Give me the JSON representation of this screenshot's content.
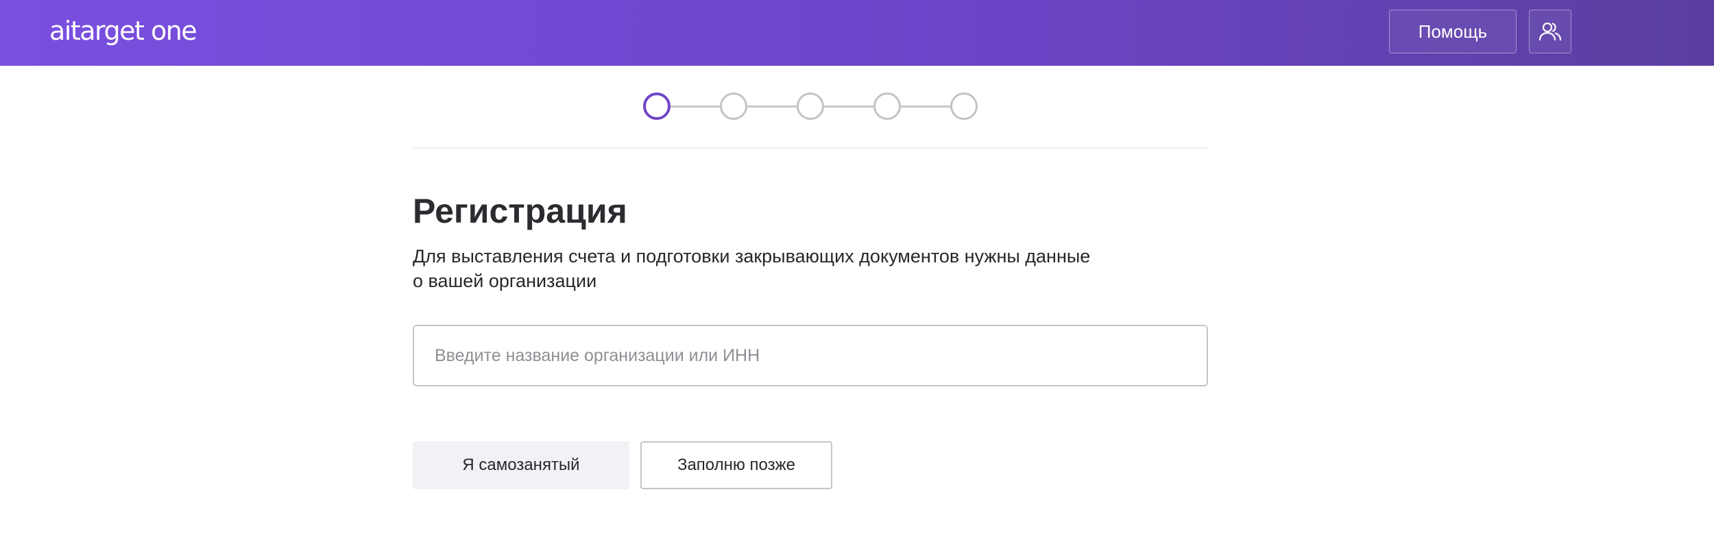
{
  "header": {
    "logo_text": "aitarget one",
    "help_label": "Помощь",
    "account_icon": "users-icon",
    "gradient_start": "#7a4fe0",
    "gradient_end": "#5a3fa0"
  },
  "stepper": {
    "total_steps": 5,
    "current_step": 1,
    "active_color": "#6e44c8",
    "inactive_color": "#c2c3c7"
  },
  "main": {
    "title": "Регистрация",
    "subtitle_line1": "Для выставления счета и подготовки закрывающих документов нужны данные",
    "subtitle_line2": "о вашей организации",
    "org_input": {
      "value": "",
      "placeholder": "Введите название организации или ИНН"
    },
    "self_employed_label": "Я самозанятый",
    "fill_later_label": "Заполню позже"
  }
}
